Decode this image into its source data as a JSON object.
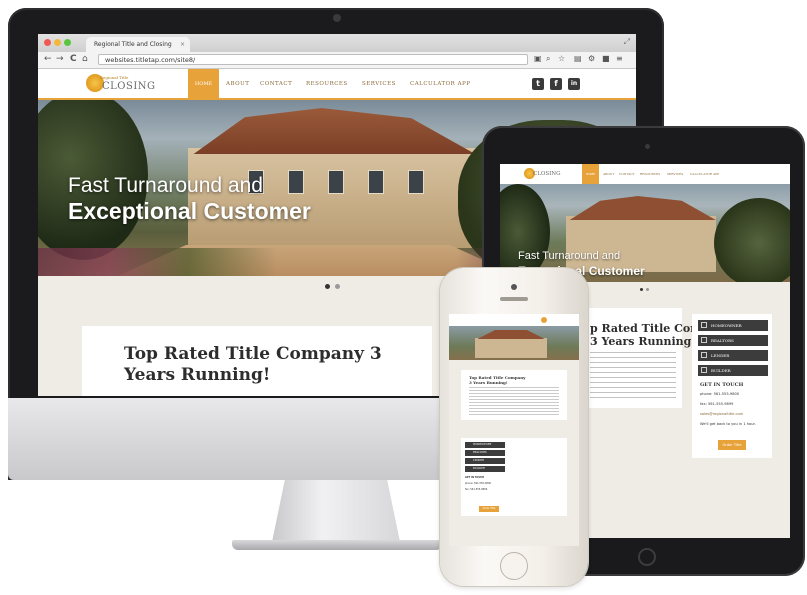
{
  "browser": {
    "tab_title": "Regional Title and Closing",
    "tab_close": "×",
    "url": "websites.titletap.com/site8/",
    "back_icon": "←",
    "forward_icon": "→",
    "reload_icon": "C",
    "home_icon": "⌂"
  },
  "site": {
    "logo_small": "Regional Title",
    "logo_word": "CLOSING",
    "nav": {
      "home": "HOME",
      "about": "ABOUT",
      "contact": "CONTACT",
      "resources": "RESOURCES",
      "services": "SERVICES",
      "calculator": "CALCULATOR APP"
    },
    "social": {
      "twitter": "t",
      "facebook": "f",
      "linkedin": "in"
    },
    "hero_line1": "Fast Turnaround and",
    "hero_line2": "Exceptional Customer",
    "content_title": "Top Rated Title Company 3 Years Running!"
  },
  "tablet": {
    "logo_word": "CLOSING",
    "nav": [
      "HOME",
      "ABOUT",
      "CONTACT",
      "RESOURCES",
      "SERVICES",
      "CALCULATOR APP"
    ],
    "hero_line1": "Fast Turnaround and",
    "hero_line2": "Exceptional Customer",
    "title_line1": "p Rated Title Com-",
    "title_line2": "3 Years Running!",
    "sidebar_buttons": [
      "HOMEOWNER",
      "REALTORS",
      "LENDER",
      "BUILDER"
    ],
    "get_in_touch": "GET IN TOUCH",
    "phone": "phone: 561-555-9800",
    "fax": "fax: 561-555-9899",
    "email": "sales@regionaltitle.com",
    "note": "We'll get back to you in 1 hour.",
    "cta": "Order Title"
  },
  "phone": {
    "title": "Top Rated Title Company 3 Years Running!",
    "sidebar_buttons": [
      "HOMEOWNER",
      "REALTORS",
      "LENDER",
      "BUILDER"
    ],
    "get_in_touch": "GET IN TOUCH",
    "phone": "phone: 561-555-9800",
    "fax": "fax: 561-555-9899",
    "cta": "Order Title"
  },
  "colors": {
    "accent": "#e8a23a",
    "dark_button": "#3c3c3c",
    "page_bg": "#efece6"
  }
}
